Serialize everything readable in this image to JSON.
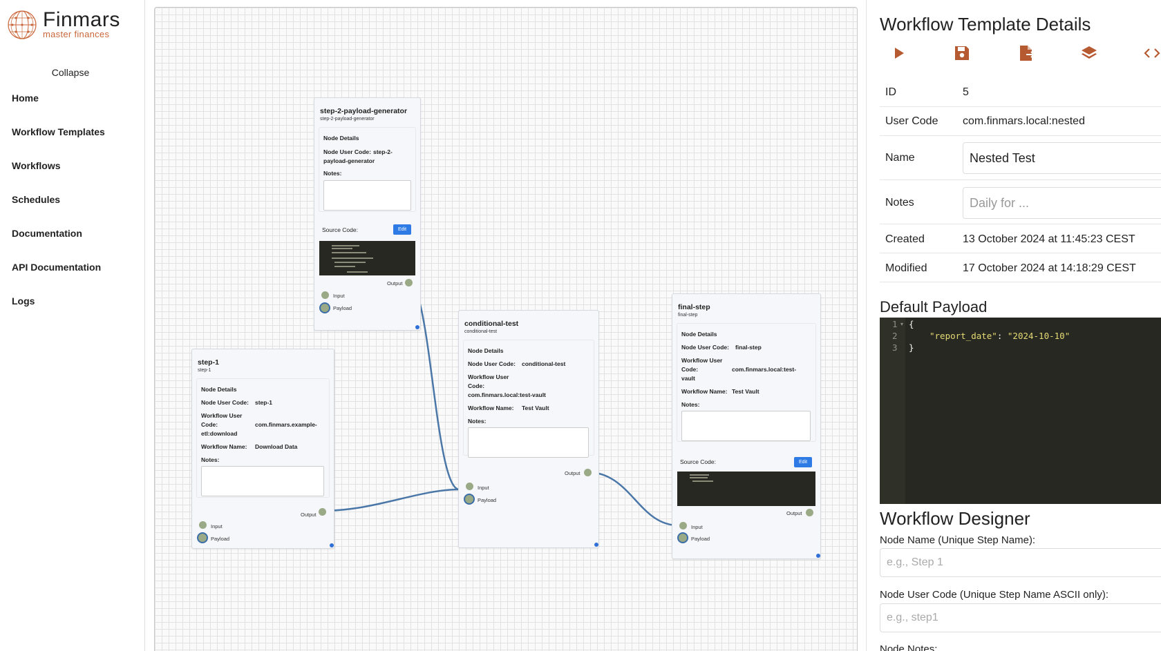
{
  "brand": {
    "name": "Finmars",
    "tagline": "master finances",
    "accent": "#c9663a"
  },
  "sidebar": {
    "collapse_label": "Collapse",
    "items": [
      {
        "label": "Home"
      },
      {
        "label": "Workflow Templates"
      },
      {
        "label": "Workflows"
      },
      {
        "label": "Schedules"
      },
      {
        "label": "Documentation"
      },
      {
        "label": "API Documentation"
      },
      {
        "label": "Logs"
      }
    ]
  },
  "canvas": {
    "nodes": {
      "gen": {
        "title": "step-2-payload-generator",
        "subtitle": "step-2-payload-generator",
        "details_heading": "Node Details",
        "user_code_label": "Node User Code:",
        "user_code_line1": "step-2-",
        "user_code_line2": "payload-generator",
        "notes_label": "Notes:",
        "source_label": "Source Code:",
        "edit_label": "Edit",
        "output_label": "Output",
        "input_label": "Input",
        "payload_label": "Payload"
      },
      "step1": {
        "title": "step-1",
        "subtitle": "step-1",
        "details_heading": "Node Details",
        "user_code_label": "Node User Code:",
        "user_code": "step-1",
        "wuc_label_1": "Workflow User",
        "wuc_label_2": "Code:",
        "wuc_value_1": "com.finmars.example-",
        "wuc_value_2": "etl:download",
        "wf_name_label": "Workflow Name:",
        "wf_name": "Download Data",
        "notes_label": "Notes:",
        "output_label": "Output",
        "input_label": "Input",
        "payload_label": "Payload"
      },
      "cond": {
        "title": "conditional-test",
        "subtitle": "conditional-test",
        "details_heading": "Node Details",
        "user_code_label": "Node User Code:",
        "user_code": "conditional-test",
        "wuc_label_1": "Workflow User",
        "wuc_label_2": "Code:",
        "wuc_value": "com.finmars.local:test-vault",
        "wf_name_label": "Workflow Name:",
        "wf_name": "Test Vault",
        "notes_label": "Notes:",
        "output_label": "Output",
        "input_label": "Input",
        "payload_label": "Payload"
      },
      "final": {
        "title": "final-step",
        "subtitle": "final-step",
        "details_heading": "Node Details",
        "user_code_label": "Node User Code:",
        "user_code": "final-step",
        "wuc_label_1": "Workflow User",
        "wuc_label_2": "Code:",
        "wuc_label_3": "vault",
        "wuc_value": "com.finmars.local:test-",
        "wf_name_label": "Workflow Name:",
        "wf_name": "Test Vault",
        "notes_label": "Notes:",
        "source_label": "Source Code:",
        "edit_label": "Edit",
        "output_label": "Output",
        "input_label": "Input",
        "payload_label": "Payload"
      }
    }
  },
  "panel": {
    "title": "Workflow Template Details",
    "toolbar": {
      "run_icon": "play-icon",
      "save_icon": "save-icon",
      "export_icon": "file-export-icon",
      "layers_icon": "layers-icon",
      "code_icon": "code-icon"
    },
    "fields": {
      "id_label": "ID",
      "id_value": "5",
      "user_code_label": "User Code",
      "user_code_value": "com.finmars.local:nested",
      "name_label": "Name",
      "name_value": "Nested Test",
      "notes_label": "Notes",
      "notes_placeholder": "Daily for ...",
      "created_label": "Created",
      "created_value": "13 October 2024 at 11:45:23 CEST",
      "modified_label": "Modified",
      "modified_value": "17 October 2024 at 14:18:29 CEST"
    },
    "default_payload_heading": "Default Payload",
    "payload_lines": {
      "l1": "{",
      "l2_key": "\"report_date\"",
      "l2_sep": ": ",
      "l2_val": "\"2024-10-10\"",
      "l3": "}",
      "n1": "1",
      "n2": "2",
      "n3": "3"
    },
    "designer_heading": "Workflow Designer",
    "node_name_label": "Node Name (Unique Step Name):",
    "node_name_placeholder": "e.g., Step 1",
    "node_user_code_label": "Node User Code (Unique Step Name ASCII only):",
    "node_user_code_placeholder": "e.g., step1",
    "node_notes_label": "Node Notes:"
  },
  "colors": {
    "edge": "#4a77a8",
    "port": "#9aaa86",
    "edit_button": "#2f7be5"
  }
}
